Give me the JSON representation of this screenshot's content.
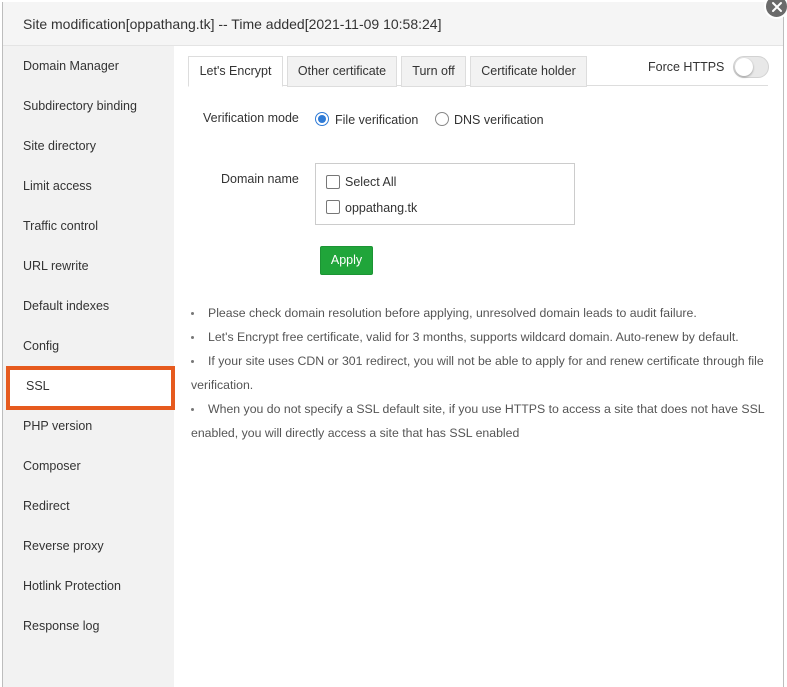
{
  "dialog": {
    "title": "Site modification[oppathang.tk] -- Time added[2021-11-09 10:58:24]"
  },
  "sidebar": {
    "items": [
      {
        "label": "Domain Manager"
      },
      {
        "label": "Subdirectory binding"
      },
      {
        "label": "Site directory"
      },
      {
        "label": "Limit access"
      },
      {
        "label": "Traffic control"
      },
      {
        "label": "URL rewrite"
      },
      {
        "label": "Default indexes"
      },
      {
        "label": "Config"
      },
      {
        "label": "SSL"
      },
      {
        "label": "PHP version"
      },
      {
        "label": "Composer"
      },
      {
        "label": "Redirect"
      },
      {
        "label": "Reverse proxy"
      },
      {
        "label": "Hotlink Protection"
      },
      {
        "label": "Response log"
      }
    ],
    "active": "SSL"
  },
  "tabs": [
    {
      "label": "Let's Encrypt"
    },
    {
      "label": "Other certificate"
    },
    {
      "label": "Turn off"
    },
    {
      "label": "Certificate holder"
    }
  ],
  "active_tab": "Let's Encrypt",
  "force_https": {
    "label": "Force HTTPS",
    "enabled": false
  },
  "verification": {
    "label": "Verification mode",
    "options": [
      {
        "label": "File verification",
        "checked": true
      },
      {
        "label": "DNS verification",
        "checked": false
      }
    ]
  },
  "domain": {
    "label": "Domain name",
    "options": [
      {
        "label": "Select All",
        "checked": false
      },
      {
        "label": "oppathang.tk",
        "checked": false
      }
    ]
  },
  "apply_label": "Apply",
  "notes": [
    "Please check domain resolution before applying, unresolved domain leads to audit failure.",
    "Let's Encrypt free certificate, valid for 3 months, supports wildcard domain. Auto-renew by default.",
    "If your site uses CDN or 301 redirect, you will not be able to apply for and renew certificate through file verification.",
    "When you do not specify a SSL default site, if you use HTTPS to access a site that does not have SSL enabled, you will directly access a site that has SSL enabled"
  ],
  "colors": {
    "accent_green": "#20a53a",
    "active_border": "#e65a1e",
    "radio_blue": "#2f7bd6"
  }
}
